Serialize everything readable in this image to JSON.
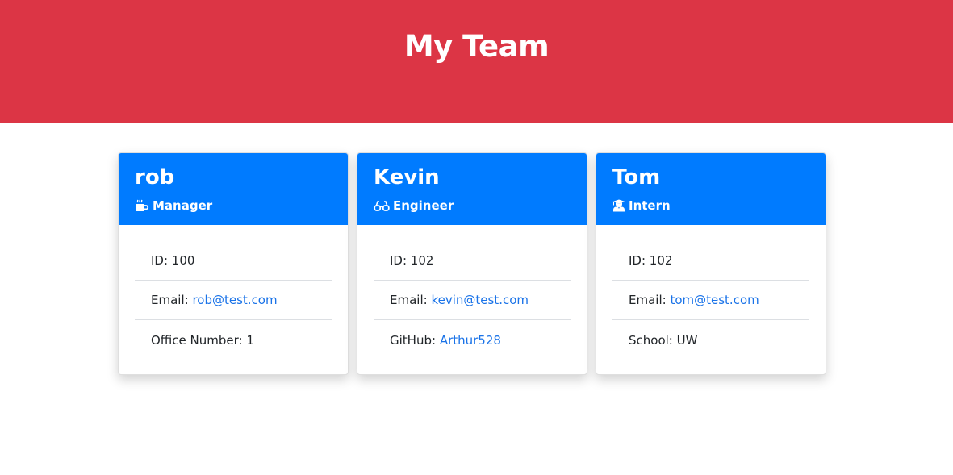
{
  "header": {
    "title": "My Team"
  },
  "colors": {
    "header_bg": "#dc3545",
    "card_header_bg": "#007bff",
    "link": "#1a73e8"
  },
  "cards": [
    {
      "name": "rob",
      "role": "Manager",
      "icon": "mug-hot-icon",
      "id_label": "ID: ",
      "id_value": "100",
      "email_label": "Email: ",
      "email_value": "rob@test.com",
      "extra_label": "Office Number: ",
      "extra_value": "1"
    },
    {
      "name": "Kevin",
      "role": "Engineer",
      "icon": "glasses-icon",
      "id_label": "ID: ",
      "id_value": "102",
      "email_label": "Email: ",
      "email_value": "kevin@test.com",
      "extra_label": "GitHub: ",
      "extra_value": "Arthur528"
    },
    {
      "name": "Tom",
      "role": "Intern",
      "icon": "user-graduate-icon",
      "id_label": "ID: ",
      "id_value": "102",
      "email_label": "Email: ",
      "email_value": "tom@test.com",
      "extra_label": "School: ",
      "extra_value": "UW"
    }
  ]
}
